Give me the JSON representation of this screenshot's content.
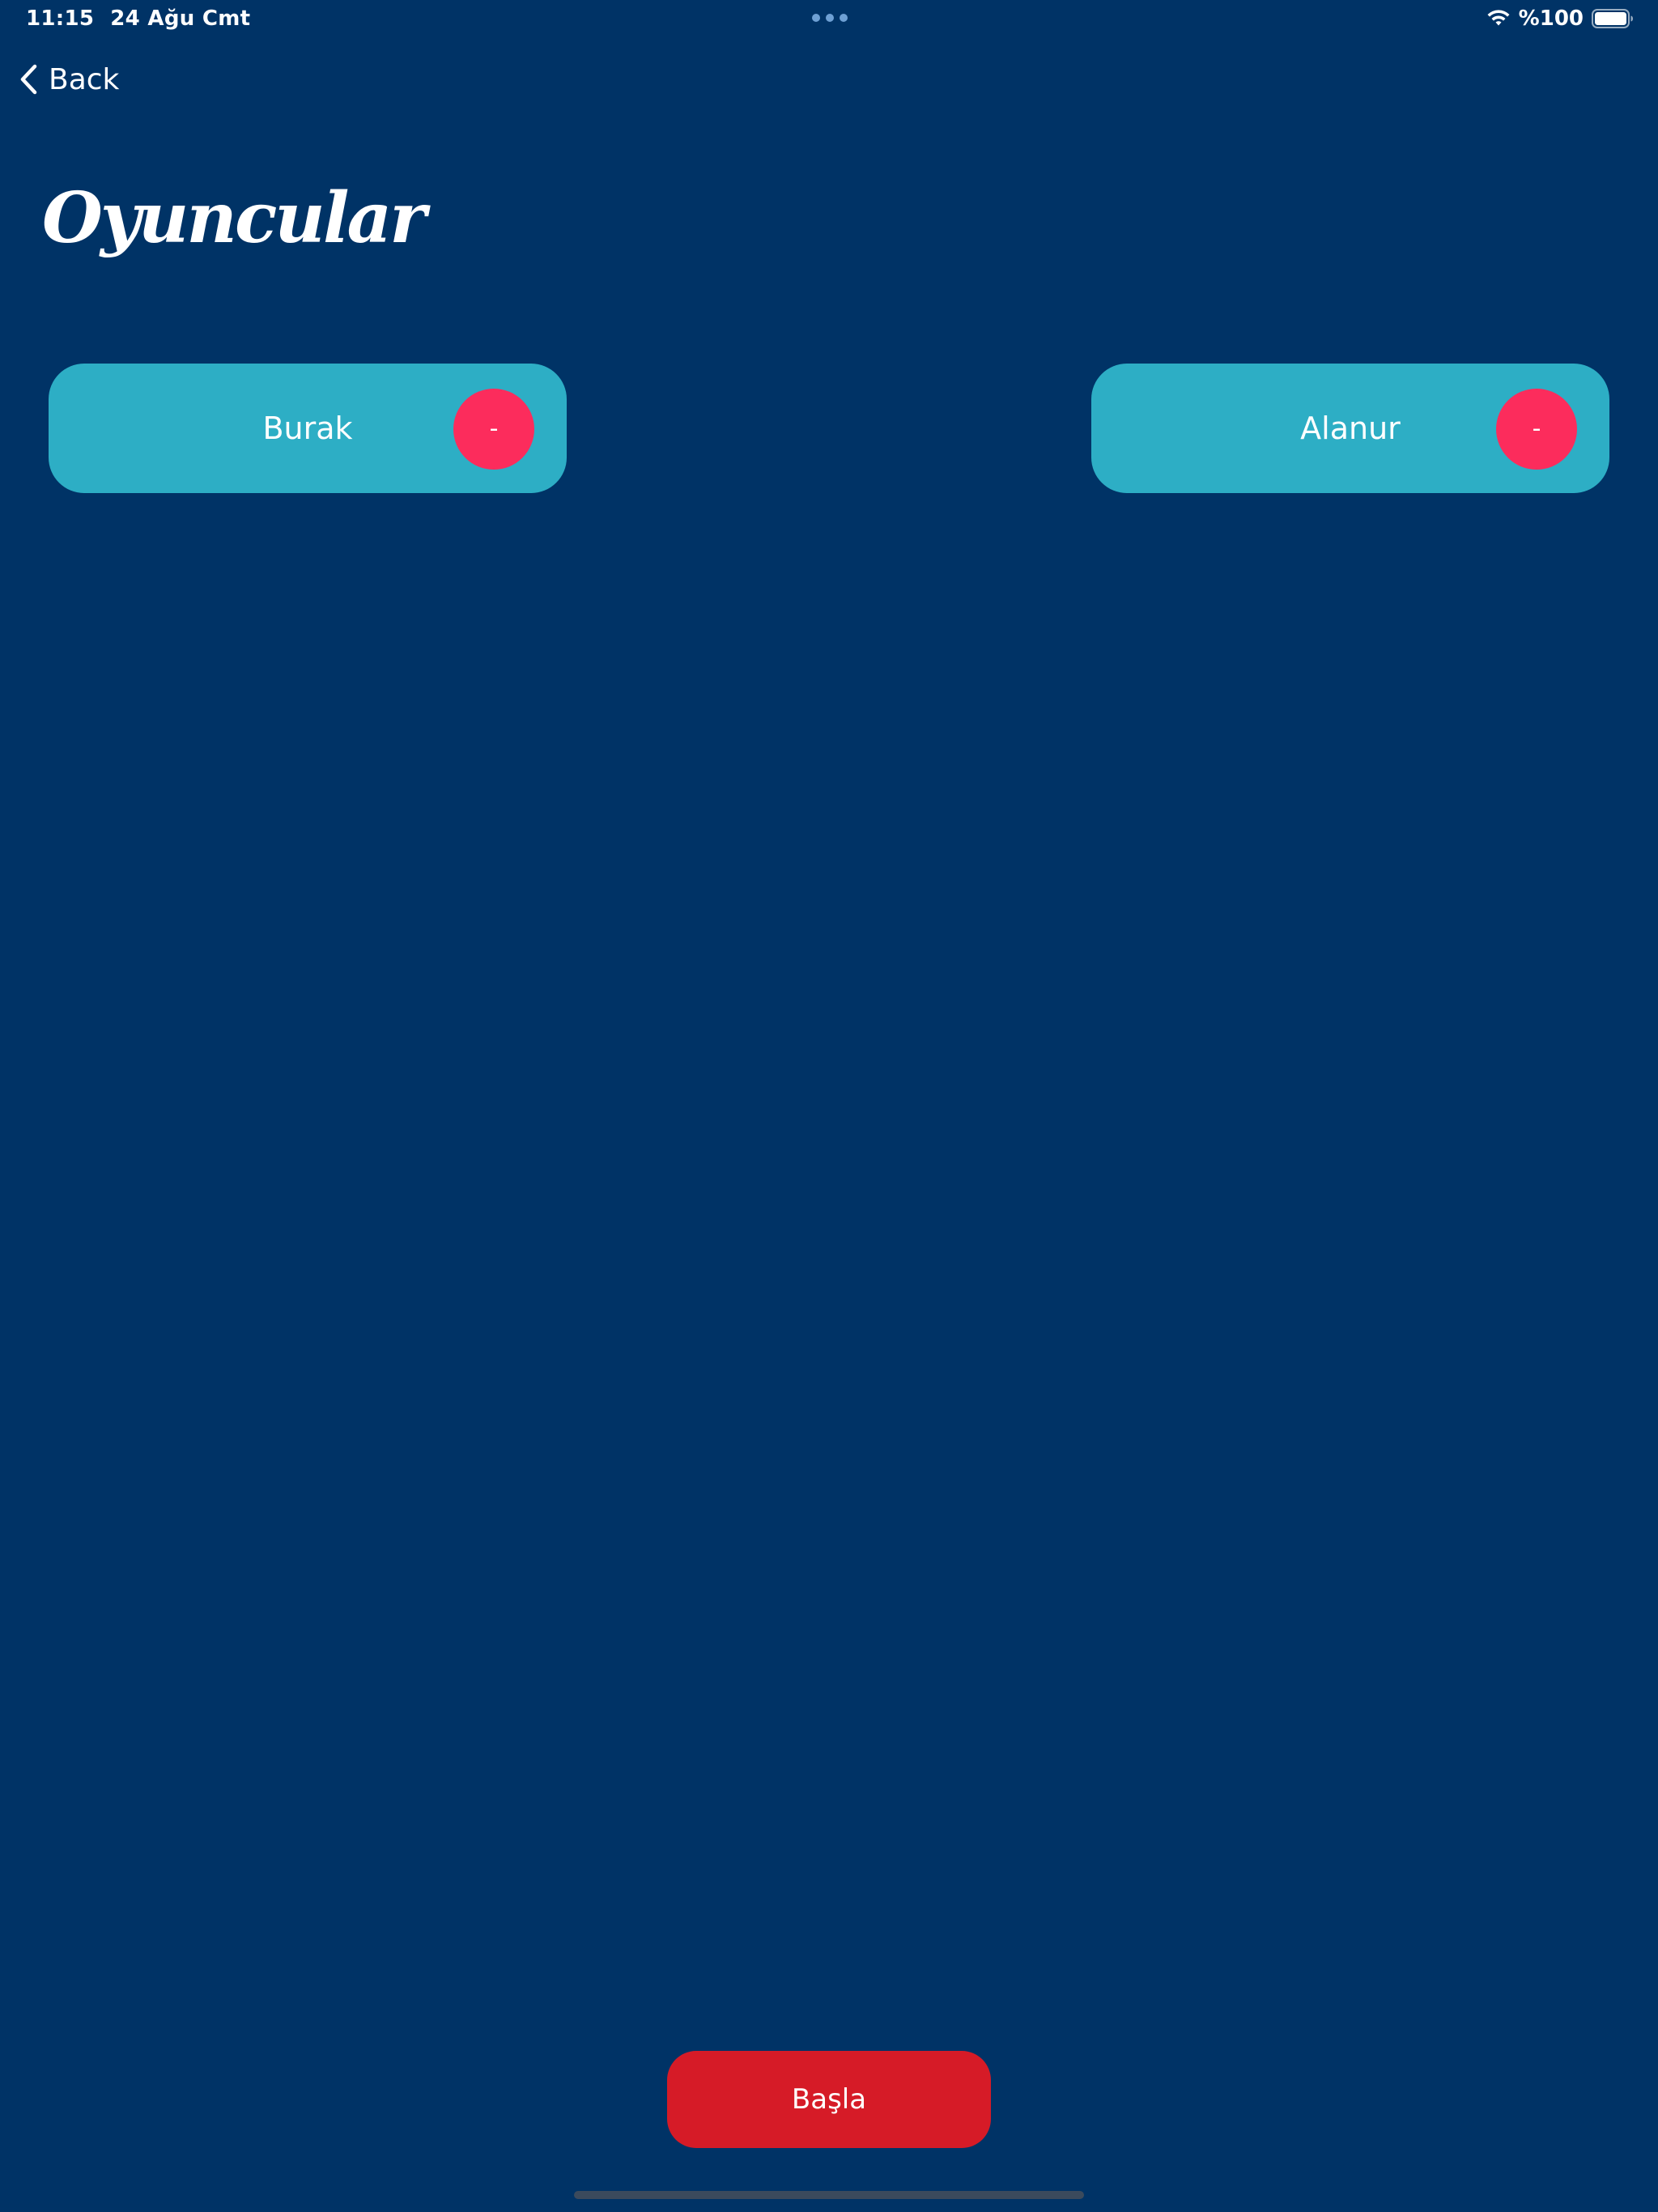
{
  "status_bar": {
    "time": "11:15",
    "date": "24 Ağu Cmt",
    "battery_text": "%100",
    "icons": [
      "multitasking-dots-icon",
      "wifi-icon",
      "battery-full-icon"
    ]
  },
  "navigation": {
    "back_label": "Back",
    "back_icon": "chevron-left-icon"
  },
  "page": {
    "title": "Oyuncular"
  },
  "players": [
    {
      "name": "Burak",
      "remove_label": "-"
    },
    {
      "name": "Alanur",
      "remove_label": "-"
    }
  ],
  "actions": {
    "start_label": "Başla"
  },
  "colors": {
    "background": "#003366",
    "card": "#2DAEC5",
    "remove_button": "#FC2C5C",
    "start_button": "#D61B27",
    "text": "#FFFFFF"
  }
}
